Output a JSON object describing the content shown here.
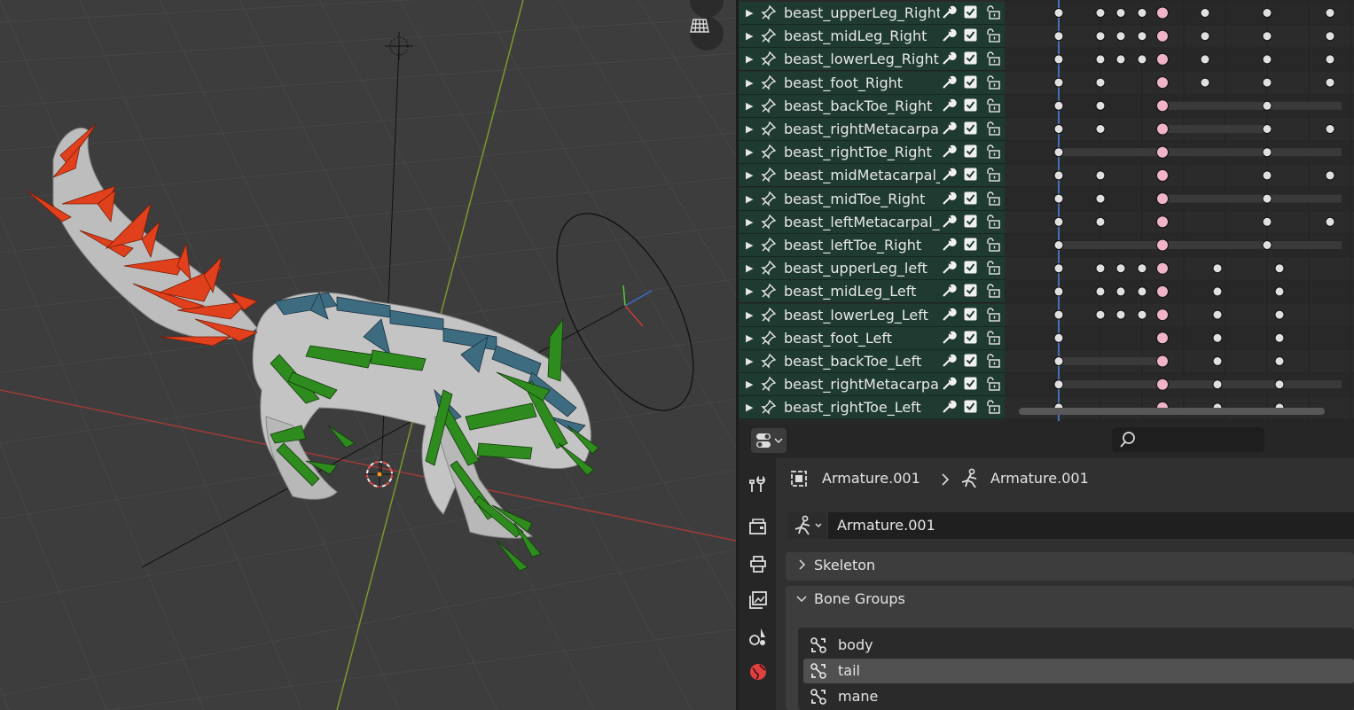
{
  "viewport": {
    "tools": [
      "camera-icon",
      "grid-icon"
    ]
  },
  "dopesheet": {
    "channels": [
      "beast_upperLeg_Right",
      "beast_midLeg_Right",
      "beast_lowerLeg_Right",
      "beast_foot_Right",
      "beast_backToe_Right",
      "beast_rightMetacarpal_",
      "beast_rightToe_Right",
      "beast_midMetacarpal_",
      "beast_midToe_Right",
      "beast_leftMetacarpal_",
      "beast_leftToe_Right",
      "beast_upperLeg_left",
      "beast_midLeg_Left",
      "beast_lowerLeg_Left",
      "beast_foot_Left",
      "beast_backToe_Left",
      "beast_rightMetacarpal",
      "beast_rightToe_Left"
    ]
  },
  "properties": {
    "breadcrumb": {
      "object": "Armature.001",
      "data": "Armature.001"
    },
    "armature_data_name": "Armature.001",
    "panels": {
      "skeleton": "Skeleton",
      "bone_groups": "Bone Groups"
    },
    "bone_groups": [
      "body",
      "tail",
      "mane"
    ],
    "selected_group": "tail",
    "tabs": [
      "tool-icon",
      "render-icon",
      "output-icon",
      "view-layer-icon",
      "scene-icon",
      "world-icon"
    ]
  },
  "colors": {
    "channel_bg": "#1e3a31",
    "key_selected": "#f0b4c8",
    "key_normal": "#e0e0e0",
    "playhead": "#4a78c8",
    "bone_green": "#2e8b1e",
    "bone_red": "#e0401c",
    "bone_teal": "#3d6b80"
  }
}
